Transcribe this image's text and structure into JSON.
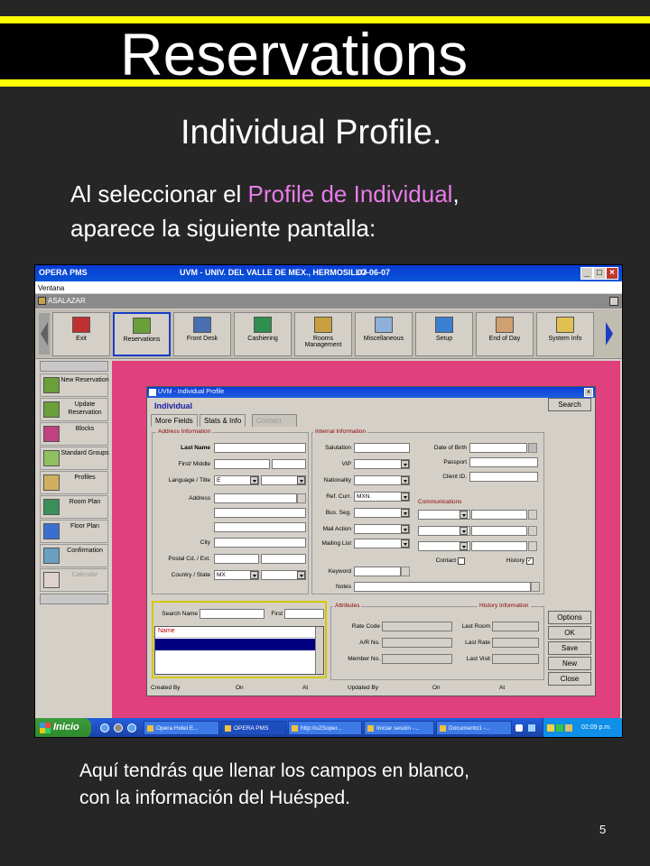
{
  "slide": {
    "title": "Reservations",
    "subtitle": "Individual Profile.",
    "intro_part1": "Al seleccionar el ",
    "intro_highlight": "Profile de Individual",
    "intro_part2": ",",
    "intro_line2": "aparece la siguiente pantalla:",
    "footer_line1": "Aquí tendrás que llenar los campos en blanco,",
    "footer_line2": "con la información del Huésped.",
    "page_number": "5",
    "colors": {
      "band": "#ffff00",
      "highlight": "#e87ce8",
      "background": "#262626"
    }
  },
  "app": {
    "title_left": "OPERA PMS",
    "title_center": "UVM - UNIV. DEL VALLE DE MEX., HERMOSILLO",
    "title_date": "07-06-07",
    "menu": "Ventana",
    "user": "ASALAZAR",
    "toolbar": [
      {
        "label": "Exit",
        "icon": "exit-door-icon"
      },
      {
        "label": "Reservations",
        "icon": "reservations-icon"
      },
      {
        "label": "Front Desk",
        "icon": "front-desk-icon"
      },
      {
        "label": "Cashiering",
        "icon": "cashiering-icon"
      },
      {
        "label": "Rooms Management",
        "icon": "key-icon"
      },
      {
        "label": "Miscellaneous",
        "icon": "miscellaneous-icon"
      },
      {
        "label": "Setup",
        "icon": "setup-icon"
      },
      {
        "label": "End of Day",
        "icon": "end-of-day-icon"
      },
      {
        "label": "System Info",
        "icon": "system-info-icon"
      }
    ],
    "left_menu": [
      {
        "label": "New Reservation"
      },
      {
        "label": "Update Reservation"
      },
      {
        "label": "Blocks"
      },
      {
        "label": "Standard Groups"
      },
      {
        "label": "Profiles"
      },
      {
        "label": "Room Plan"
      },
      {
        "label": "Floor Plan"
      },
      {
        "label": "Confirmation"
      },
      {
        "label": "Calendar"
      }
    ]
  },
  "dialog": {
    "title": "UVM - Individual Profile",
    "header": "Individual",
    "tabs": [
      "More Fields",
      "Stats & Info",
      "Contact"
    ],
    "buttons": {
      "search": "Search",
      "options": "Options",
      "ok": "OK",
      "save": "Save",
      "new": "New",
      "close": "Close"
    },
    "address": {
      "group": "Address Information",
      "last_name": "Last Name",
      "first_middle": "First/ Middle",
      "language_title": "Language / Title",
      "language_value": "E",
      "address": "Address",
      "city": "City",
      "postal": "Postal Cd. / Ext.",
      "country_state": "Country / State",
      "country_value": "MX"
    },
    "internal": {
      "group": "Internal Information",
      "salutation": "Salutation",
      "vip": "VIP",
      "nationality": "Nationality",
      "ref_curr": "Ref. Curr.",
      "ref_curr_value": "MXN",
      "bus_seg": "Bus. Seg.",
      "mail_action": "Mail Action",
      "mailing_list": "Mailing List",
      "keyword": "Keyword",
      "notes": "Notes",
      "dob": "Date of Birth",
      "passport": "Passport",
      "client_id": "Client ID.",
      "communications": "Communications",
      "contact": "Contact",
      "history": "History"
    },
    "search": {
      "label": "Search Name",
      "first": "First",
      "col_name": "Name"
    },
    "attributes": {
      "group": "Attributes",
      "rate_code": "Rate Code",
      "ar_no": "A/R No.",
      "member_no": "Member No."
    },
    "history": {
      "group": "History Information",
      "last_room": "Last Room",
      "last_rate": "Last Rate",
      "last_visit": "Last Visit"
    },
    "status": {
      "created_by": "Created By",
      "on1": "On",
      "at1": "At",
      "updated_by": "Updated By",
      "on2": "On",
      "at2": "At"
    }
  },
  "taskbar": {
    "start": "Inicio",
    "tasks": [
      "Opera Hotel E...",
      "OPERA PMS",
      "http://u2Soper...",
      "Iniciar sesión -...",
      "Documento1 -..."
    ],
    "clock": "02:09 p.m."
  }
}
